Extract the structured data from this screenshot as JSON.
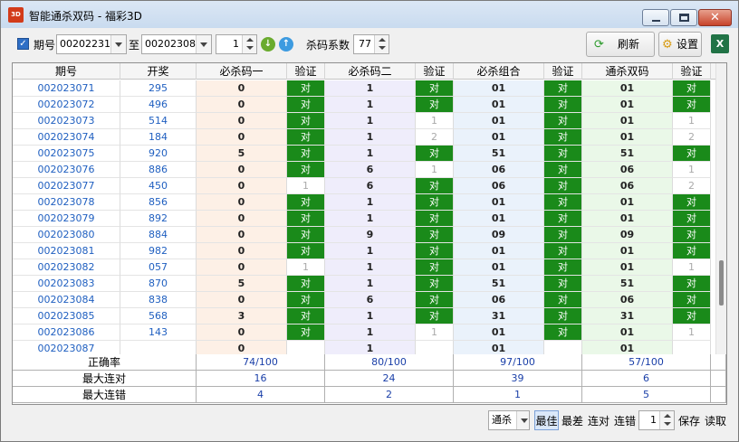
{
  "window": {
    "title": "智能通杀双码 - 福彩3D",
    "app_icon_text": "3D",
    "close_glyph": "✕"
  },
  "toolbar": {
    "period_checkbox_checked": true,
    "period_label": "期号",
    "period_from": "002022318",
    "to_label": "至",
    "period_to": "002023086",
    "offset_value": "1",
    "kill_coef_label": "杀码系数",
    "kill_coef_value": "77",
    "refresh_label": "刷新",
    "settings_label": "设置",
    "excel_icon_text": "X"
  },
  "grid": {
    "headers": [
      "期号",
      "开奖",
      "必杀码一",
      "验证",
      "必杀码二",
      "验证",
      "必杀组合",
      "验证",
      "通杀双码",
      "验证"
    ],
    "rows": [
      {
        "period": "002023071",
        "draw": "295",
        "k1": "0",
        "v1": "对",
        "k2": "1",
        "v2": "对",
        "k3": "01",
        "v3": "对",
        "k4": "01",
        "v4": "对"
      },
      {
        "period": "002023072",
        "draw": "496",
        "k1": "0",
        "v1": "对",
        "k2": "1",
        "v2": "对",
        "k3": "01",
        "v3": "对",
        "k4": "01",
        "v4": "对"
      },
      {
        "period": "002023073",
        "draw": "514",
        "k1": "0",
        "v1": "对",
        "k2": "1",
        "v2": "1",
        "k3": "01",
        "v3": "对",
        "k4": "01",
        "v4": "1"
      },
      {
        "period": "002023074",
        "draw": "184",
        "k1": "0",
        "v1": "对",
        "k2": "1",
        "v2": "2",
        "k3": "01",
        "v3": "对",
        "k4": "01",
        "v4": "2"
      },
      {
        "period": "002023075",
        "draw": "920",
        "k1": "5",
        "v1": "对",
        "k2": "1",
        "v2": "对",
        "k3": "51",
        "v3": "对",
        "k4": "51",
        "v4": "对"
      },
      {
        "period": "002023076",
        "draw": "886",
        "k1": "0",
        "v1": "对",
        "k2": "6",
        "v2": "1",
        "k3": "06",
        "v3": "对",
        "k4": "06",
        "v4": "1"
      },
      {
        "period": "002023077",
        "draw": "450",
        "k1": "0",
        "v1": "1",
        "k2": "6",
        "v2": "对",
        "k3": "06",
        "v3": "对",
        "k4": "06",
        "v4": "2"
      },
      {
        "period": "002023078",
        "draw": "856",
        "k1": "0",
        "v1": "对",
        "k2": "1",
        "v2": "对",
        "k3": "01",
        "v3": "对",
        "k4": "01",
        "v4": "对"
      },
      {
        "period": "002023079",
        "draw": "892",
        "k1": "0",
        "v1": "对",
        "k2": "1",
        "v2": "对",
        "k3": "01",
        "v3": "对",
        "k4": "01",
        "v4": "对"
      },
      {
        "period": "002023080",
        "draw": "884",
        "k1": "0",
        "v1": "对",
        "k2": "9",
        "v2": "对",
        "k3": "09",
        "v3": "对",
        "k4": "09",
        "v4": "对"
      },
      {
        "period": "002023081",
        "draw": "982",
        "k1": "0",
        "v1": "对",
        "k2": "1",
        "v2": "对",
        "k3": "01",
        "v3": "对",
        "k4": "01",
        "v4": "对"
      },
      {
        "period": "002023082",
        "draw": "057",
        "k1": "0",
        "v1": "1",
        "k2": "1",
        "v2": "对",
        "k3": "01",
        "v3": "对",
        "k4": "01",
        "v4": "1"
      },
      {
        "period": "002023083",
        "draw": "870",
        "k1": "5",
        "v1": "对",
        "k2": "1",
        "v2": "对",
        "k3": "51",
        "v3": "对",
        "k4": "51",
        "v4": "对"
      },
      {
        "period": "002023084",
        "draw": "838",
        "k1": "0",
        "v1": "对",
        "k2": "6",
        "v2": "对",
        "k3": "06",
        "v3": "对",
        "k4": "06",
        "v4": "对"
      },
      {
        "period": "002023085",
        "draw": "568",
        "k1": "3",
        "v1": "对",
        "k2": "1",
        "v2": "对",
        "k3": "31",
        "v3": "对",
        "k4": "31",
        "v4": "对"
      },
      {
        "period": "002023086",
        "draw": "143",
        "k1": "0",
        "v1": "对",
        "k2": "1",
        "v2": "1",
        "k3": "01",
        "v3": "对",
        "k4": "01",
        "v4": "1"
      },
      {
        "period": "002023087",
        "draw": "",
        "k1": "0",
        "v1": "",
        "k2": "1",
        "v2": "",
        "k3": "01",
        "v3": "",
        "k4": "01",
        "v4": ""
      }
    ]
  },
  "summary": {
    "rows": [
      {
        "label": "正确率",
        "values": [
          "74/100",
          "80/100",
          "97/100",
          "57/100"
        ]
      },
      {
        "label": "最大连对",
        "values": [
          "16",
          "24",
          "39",
          "6"
        ]
      },
      {
        "label": "最大连错",
        "values": [
          "4",
          "2",
          "1",
          "5"
        ]
      }
    ]
  },
  "bottom": {
    "mode_select": "通杀",
    "buttons": [
      "最佳",
      "最差",
      "连对",
      "连错"
    ],
    "active_button": "最佳",
    "spin_value": "1",
    "save_label": "保存",
    "read_label": "读取"
  },
  "colors": {
    "correct_cell": "#1a8a1a",
    "column_kill1": "#fdf0e6",
    "column_kill2": "#efedfb",
    "column_combo": "#eaf2fb",
    "column_double": "#eaf8e8",
    "link_blue": "#1f5fc0"
  }
}
